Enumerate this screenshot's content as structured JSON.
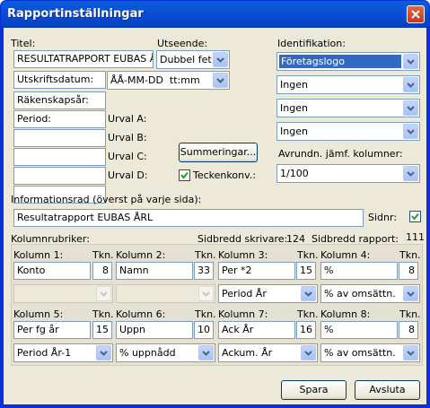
{
  "window": {
    "title": "Rapportinställningar"
  },
  "titel": {
    "label": "Titel:",
    "value": "RESULTATRAPPORT EUBAS ÅRL"
  },
  "utseende": {
    "label": "Utseende:",
    "value": "Dubbel fet"
  },
  "utskriftsdatum": {
    "label": "Utskriftsdatum:",
    "value": "ÅÅ-MM-DD  tt:mm"
  },
  "rakenskapsar": {
    "label": "Räkenskapsår:"
  },
  "period": {
    "label": "Period:"
  },
  "urval": {
    "a": "Urval A:",
    "b": "Urval B:",
    "c": "Urval C:",
    "d": "Urval D:"
  },
  "summeringar_button": "Summeringar...",
  "teckenkonv": {
    "label": "Teckenkonv.:",
    "checked": true
  },
  "identifikation": {
    "label": "Identifikation:",
    "options": [
      "Företagslogo",
      "Ingen",
      "Ingen",
      "Ingen"
    ]
  },
  "avrundn": {
    "label": "Avrundn. jämf. kolumner:",
    "value": "1/100"
  },
  "informationsrad": {
    "label": "Informationsrad (överst på varje sida):",
    "value": "Resultatrapport EUBAS ÅRL"
  },
  "sidnr": {
    "label": "Sidnr:",
    "checked": true
  },
  "kolumnrubriker": {
    "label": "Kolumnrubriker:"
  },
  "sidbredd": {
    "skrivare_label": "Sidbredd skrivare:",
    "skrivare_value": "124",
    "rapport_label": "Sidbredd rapport:",
    "rapport_value": "111"
  },
  "tkn_label": "Tkn.",
  "columns_row1": [
    {
      "label": "Kolumn 1:",
      "value": "Konto",
      "tkn": "8",
      "combo": ""
    },
    {
      "label": "Kolumn 2:",
      "value": "Namn",
      "tkn": "33",
      "combo": ""
    },
    {
      "label": "Kolumn 3:",
      "value": "Per *2",
      "tkn": "15",
      "combo": "Period År"
    },
    {
      "label": "Kolumn 4:",
      "value": "%",
      "tkn": "8",
      "combo": "% av omsättn."
    }
  ],
  "columns_row2": [
    {
      "label": "Kolumn 5:",
      "value": "Per fg år",
      "tkn": "15",
      "combo": "Period År-1"
    },
    {
      "label": "Kolumn 6:",
      "value": "Uppn",
      "tkn": "10",
      "combo": "% uppnådd"
    },
    {
      "label": "Kolumn 7:",
      "value": "Ack År",
      "tkn": "16",
      "combo": "Ackum. År"
    },
    {
      "label": "Kolumn 8:",
      "value": "%",
      "tkn": "8",
      "combo": "% av omsättn."
    }
  ],
  "buttons": {
    "spara": "Spara",
    "avsluta": "Avsluta"
  }
}
